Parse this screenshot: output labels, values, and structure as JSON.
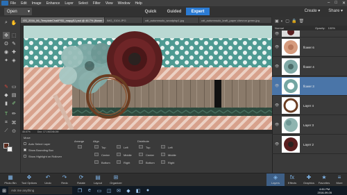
{
  "menubar": {
    "items": [
      "File",
      "Edit",
      "Image",
      "Enhance",
      "Layer",
      "Select",
      "Filter",
      "View",
      "Window",
      "Help"
    ],
    "window_controls": [
      "–",
      "□",
      "✕"
    ]
  },
  "modebar": {
    "open_label": "Open",
    "modes": [
      "Quick",
      "Guided",
      "Expert"
    ],
    "active_mode": "Expert",
    "create_label": "Create",
    "share_label": "Share"
  },
  "tabs": [
    {
      "label": "GS_2016_06_TemplateChallPSD_mapgSJ.psd @ 46.7% (flower 3, RGB/8) *",
      "active": true
    },
    {
      "label": "IMG_0104.JPG",
      "active": false
    },
    {
      "label": "cdt_autumnsolo_woodplsp1.jpg",
      "active": false
    },
    {
      "label": "cdt_autumnsolo_kraft_paper chevron green.jpg",
      "active": false
    }
  ],
  "statusbar": {
    "zoom": "46.67%",
    "doc": "Doc: 17.1M/246.0M"
  },
  "options": {
    "section_move": "Move",
    "auto_select": "Auto Select Layer",
    "bounding_box": "Show Bounding Box",
    "highlight": "Show Highlight on Rollover",
    "arrange": "Arrange",
    "align": "Align",
    "distribute": "Distribute",
    "align_items": [
      "Top",
      "Center",
      "Bottom",
      "Left",
      "Middle",
      "Right"
    ],
    "distribute_items": [
      "Top",
      "Center",
      "Bottom",
      "Left",
      "Middle",
      "Right"
    ]
  },
  "panel": {
    "blend_mode": "Normal",
    "opacity_label": "Opacity:",
    "opacity_value": "100%",
    "layers": [
      {
        "name": "",
        "selected": false
      },
      {
        "name": "flower 6",
        "selected": false
      },
      {
        "name": "flower 4",
        "selected": false
      },
      {
        "name": "flower 3",
        "selected": true
      },
      {
        "name": "Layer 4",
        "selected": false
      },
      {
        "name": "Layer 3",
        "selected": false
      },
      {
        "name": "Layer 2",
        "selected": false
      }
    ]
  },
  "dock": {
    "left": [
      "Photo Bin",
      "Tool Options",
      "Undo",
      "Redo",
      "Rotate",
      "Layout",
      "Organizer"
    ],
    "right": [
      "Layers",
      "Effects",
      "Graphics",
      "Favorites",
      "More"
    ]
  },
  "taskbar": {
    "search_placeholder": "Ask me anything",
    "time": "6:51 PM",
    "date": "2016-09-05"
  },
  "colors": {
    "accent": "#2b7bd3",
    "foreground_swatch": "#5b2b1e",
    "background_swatch": "#eeeeee",
    "teal": "#4e9a92",
    "salmon": "#d7a18c"
  }
}
